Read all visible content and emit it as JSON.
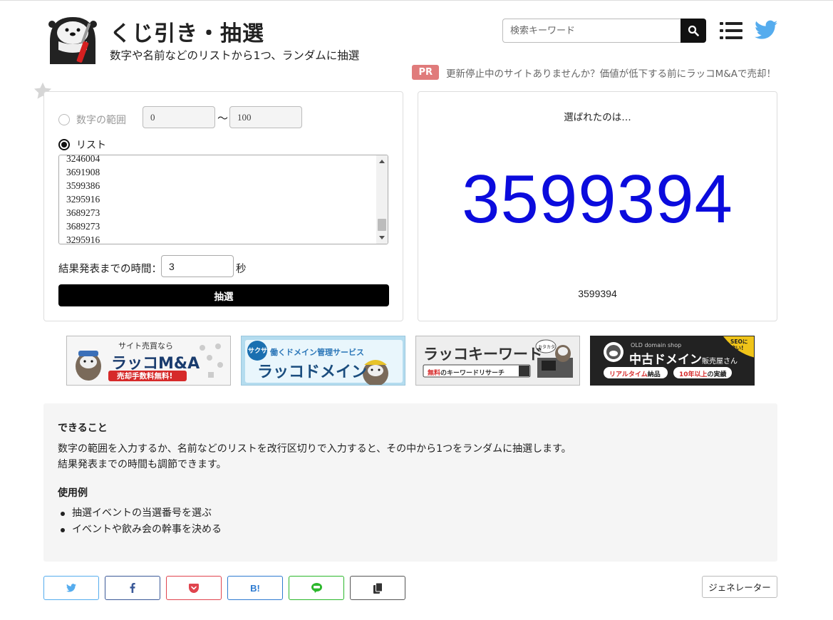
{
  "header": {
    "title": "くじ引き・抽選",
    "subtitle": "数字や名前などのリストから1つ、ランダムに抽選",
    "search_placeholder": "検索キーワード",
    "pr_badge": "PR",
    "pr_text": "更新停止中のサイトありませんか？価値が低下する前にラッコM&Aで売却！"
  },
  "form": {
    "range_label": "数字の範囲",
    "range_from": "0",
    "range_sep": "〜",
    "range_to": "100",
    "list_label": "リスト",
    "list_items": [
      "3246004",
      "3691908",
      "3599386",
      "3295916",
      "3689273",
      "3689273",
      "3295916"
    ],
    "time_label": "結果発表までの時間：",
    "time_value": "3",
    "time_unit": "秒",
    "draw_button": "抽選"
  },
  "result": {
    "label": "選ばれたのは…",
    "value": "3599394",
    "value_small": "3599394"
  },
  "banners": {
    "ma": {
      "top": "サイト売買なら",
      "main": "ラッコM&A",
      "sub": "売却手数料無料!"
    },
    "domain": {
      "badge": "サクサク",
      "top": "働くドメイン管理サービス",
      "main": "ラッコドメイン"
    },
    "keyword": {
      "main": "ラッコキーワード",
      "sub_red": "無料",
      "sub": "のキーワードリサーチ",
      "bubble": "カタカタ"
    },
    "used": {
      "top": "OLD domain shop",
      "main": "中古ドメイン",
      "main_small": "販売屋さん",
      "tag1": "リアルタイム",
      "tag1b": "納品",
      "tag2": "10年以上",
      "tag2b": "の実績",
      "seo": "SEOに強い!"
    }
  },
  "description": {
    "heading1": "できること",
    "text1": "数字の範囲を入力するか、名前などのリストを改行区切りで入力すると、その中から1つをランダムに抽選します。",
    "text2": "結果発表までの時間も調節できます。",
    "heading2": "使用例",
    "examples": [
      "抽選イベントの当選番号を選ぶ",
      "イベントや飲み会の幹事を決める"
    ]
  },
  "share": {
    "hatena": "B!",
    "generator_button": "ジェネレーター"
  },
  "colors": {
    "result": "#0b0bdd",
    "twitter": "#55acee",
    "facebook": "#3b5998",
    "pocket": "#e0444e",
    "hatena": "#2e7bd1",
    "line": "#2cb72c",
    "pr": "#e07b7b"
  }
}
